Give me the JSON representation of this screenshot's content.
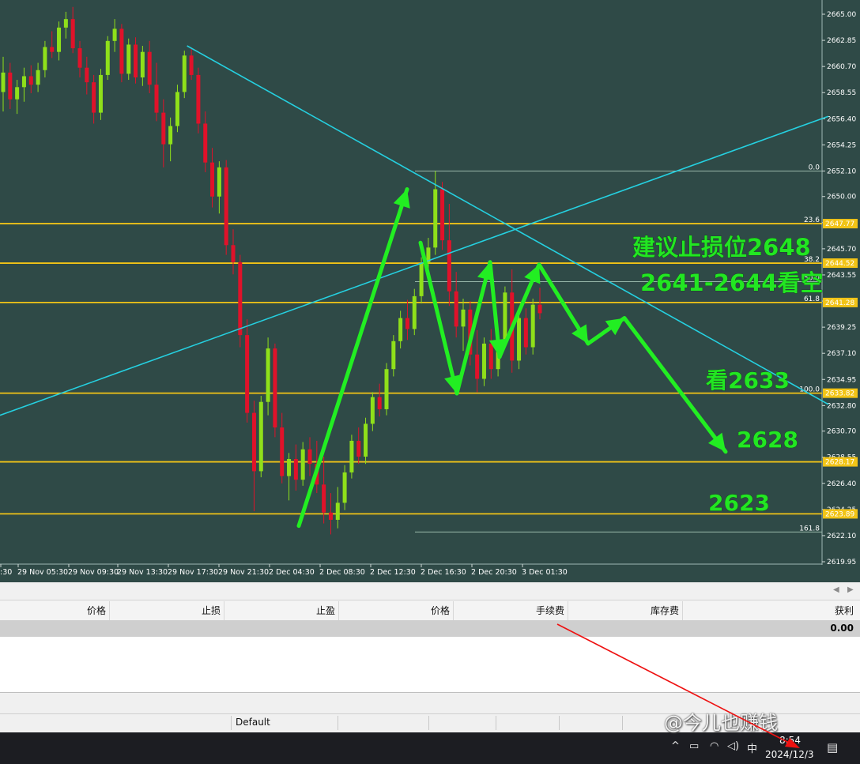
{
  "chart_data": {
    "type": "candlestick",
    "symbol_note": "",
    "ylim": [
      2619.95,
      2666.5
    ],
    "y_ticks": [
      "2665.00",
      "2662.85",
      "2660.70",
      "2658.55",
      "2656.40",
      "2654.25",
      "2652.10",
      "2650.00",
      "2647.85",
      "2645.70",
      "2643.55",
      "2641.40",
      "2639.25",
      "2637.10",
      "2634.95",
      "2632.80",
      "2630.70",
      "2628.55",
      "2626.40",
      "2624.25",
      "2622.10",
      "2619.95"
    ],
    "x_labels": [
      "29 Nov 01:30",
      "29 Nov 05:30",
      "29 Nov 09:30",
      "29 Nov 13:30",
      "29 Nov 17:30",
      "29 Nov 21:30",
      "2 Dec 04:30",
      "2 Dec 08:30",
      "2 Dec 12:30",
      "2 Dec 16:30",
      "2 Dec 20:30",
      "3 Dec 01:30"
    ],
    "x_label_display": [
      ":30",
      "29 Nov 05:30",
      "29 Nov 09:30",
      "29 Nov 13:30",
      "29 Nov 17:30",
      "29 Nov 21:30",
      "2 Dec 04:30",
      "2 Dec 08:30",
      "2 Dec 12:30",
      "2 Dec 16:30",
      "2 Dec 20:30",
      "3 Dec 01:30"
    ],
    "horizontal_levels": [
      {
        "price": 2647.77,
        "label": "2647.77"
      },
      {
        "price": 2644.52,
        "label": "2644.52"
      },
      {
        "price": 2641.28,
        "label": "2641.28"
      },
      {
        "price": 2633.82,
        "label": "2633.82"
      },
      {
        "price": 2628.17,
        "label": "2628.17"
      },
      {
        "price": 2623.89,
        "label": "2623.89"
      }
    ],
    "fibonacci": [
      {
        "ratio": "0.0",
        "price": 2652.1
      },
      {
        "ratio": "23.6",
        "price": 2647.77
      },
      {
        "ratio": "38.2",
        "price": 2644.52
      },
      {
        "ratio": "50.0",
        "price": 2643.0
      },
      {
        "ratio": "61.8",
        "price": 2641.28
      },
      {
        "ratio": "100.0",
        "price": 2633.82
      },
      {
        "ratio": "161.8",
        "price": 2622.4
      }
    ],
    "fib_visible_labels": [
      "0.0",
      "23.6",
      "38.2",
      "50.0",
      "61.8",
      "100.0",
      "161.8"
    ],
    "candles": [
      {
        "o": 2658.6,
        "h": 2661.5,
        "l": 2657.0,
        "c": 2660.2
      },
      {
        "o": 2660.2,
        "h": 2661.0,
        "l": 2657.2,
        "c": 2658.0
      },
      {
        "o": 2658.0,
        "h": 2659.6,
        "l": 2656.8,
        "c": 2659.0
      },
      {
        "o": 2659.0,
        "h": 2660.6,
        "l": 2657.8,
        "c": 2659.9
      },
      {
        "o": 2659.9,
        "h": 2660.8,
        "l": 2658.5,
        "c": 2659.2
      },
      {
        "o": 2659.2,
        "h": 2661.0,
        "l": 2658.6,
        "c": 2660.4
      },
      {
        "o": 2660.4,
        "h": 2662.8,
        "l": 2659.8,
        "c": 2662.3
      },
      {
        "o": 2662.3,
        "h": 2663.6,
        "l": 2661.4,
        "c": 2661.9
      },
      {
        "o": 2661.9,
        "h": 2664.4,
        "l": 2661.2,
        "c": 2663.9
      },
      {
        "o": 2663.9,
        "h": 2665.2,
        "l": 2663.0,
        "c": 2664.6
      },
      {
        "o": 2664.6,
        "h": 2665.6,
        "l": 2661.8,
        "c": 2662.2
      },
      {
        "o": 2662.2,
        "h": 2662.8,
        "l": 2659.8,
        "c": 2660.6
      },
      {
        "o": 2660.6,
        "h": 2661.5,
        "l": 2658.4,
        "c": 2659.4
      },
      {
        "o": 2659.4,
        "h": 2660.0,
        "l": 2656.0,
        "c": 2656.9
      },
      {
        "o": 2656.9,
        "h": 2660.5,
        "l": 2656.3,
        "c": 2660.0
      },
      {
        "o": 2660.0,
        "h": 2663.2,
        "l": 2659.6,
        "c": 2662.8
      },
      {
        "o": 2662.8,
        "h": 2664.6,
        "l": 2661.9,
        "c": 2663.8
      },
      {
        "o": 2663.8,
        "h": 2664.2,
        "l": 2659.4,
        "c": 2660.1
      },
      {
        "o": 2660.1,
        "h": 2663.0,
        "l": 2659.6,
        "c": 2662.5
      },
      {
        "o": 2662.5,
        "h": 2663.1,
        "l": 2659.3,
        "c": 2659.8
      },
      {
        "o": 2659.8,
        "h": 2662.4,
        "l": 2659.1,
        "c": 2661.9
      },
      {
        "o": 2661.9,
        "h": 2662.8,
        "l": 2658.5,
        "c": 2659.2
      },
      {
        "o": 2659.2,
        "h": 2661.0,
        "l": 2656.2,
        "c": 2656.9
      },
      {
        "o": 2656.9,
        "h": 2658.0,
        "l": 2652.4,
        "c": 2654.3
      },
      {
        "o": 2654.3,
        "h": 2656.5,
        "l": 2652.9,
        "c": 2655.8
      },
      {
        "o": 2655.8,
        "h": 2659.2,
        "l": 2655.3,
        "c": 2658.6
      },
      {
        "o": 2658.6,
        "h": 2662.0,
        "l": 2658.1,
        "c": 2661.6
      },
      {
        "o": 2661.6,
        "h": 2662.2,
        "l": 2659.6,
        "c": 2660.0
      },
      {
        "o": 2660.0,
        "h": 2660.6,
        "l": 2655.2,
        "c": 2656.0
      },
      {
        "o": 2656.0,
        "h": 2657.0,
        "l": 2652.0,
        "c": 2652.8
      },
      {
        "o": 2652.8,
        "h": 2654.0,
        "l": 2649.1,
        "c": 2650.0
      },
      {
        "o": 2650.0,
        "h": 2652.9,
        "l": 2648.6,
        "c": 2652.4
      },
      {
        "o": 2652.4,
        "h": 2653.0,
        "l": 2645.2,
        "c": 2646.0
      },
      {
        "o": 2646.0,
        "h": 2647.3,
        "l": 2643.6,
        "c": 2644.6
      },
      {
        "o": 2644.6,
        "h": 2645.2,
        "l": 2637.6,
        "c": 2638.6
      },
      {
        "o": 2638.6,
        "h": 2639.9,
        "l": 2631.4,
        "c": 2632.2
      },
      {
        "o": 2632.2,
        "h": 2633.2,
        "l": 2624.1,
        "c": 2627.4
      },
      {
        "o": 2627.4,
        "h": 2633.6,
        "l": 2626.9,
        "c": 2633.1
      },
      {
        "o": 2633.1,
        "h": 2638.4,
        "l": 2632.0,
        "c": 2637.5
      },
      {
        "o": 2637.5,
        "h": 2637.9,
        "l": 2630.2,
        "c": 2631.0
      },
      {
        "o": 2631.0,
        "h": 2632.2,
        "l": 2626.4,
        "c": 2627.0
      },
      {
        "o": 2627.0,
        "h": 2628.9,
        "l": 2625.0,
        "c": 2628.4
      },
      {
        "o": 2628.4,
        "h": 2629.6,
        "l": 2625.8,
        "c": 2626.7
      },
      {
        "o": 2626.7,
        "h": 2629.8,
        "l": 2626.2,
        "c": 2629.2
      },
      {
        "o": 2629.2,
        "h": 2630.2,
        "l": 2627.0,
        "c": 2628.0
      },
      {
        "o": 2628.0,
        "h": 2629.9,
        "l": 2625.6,
        "c": 2626.3
      },
      {
        "o": 2626.3,
        "h": 2628.6,
        "l": 2623.1,
        "c": 2624.0
      },
      {
        "o": 2624.0,
        "h": 2625.6,
        "l": 2622.2,
        "c": 2623.4
      },
      {
        "o": 2623.4,
        "h": 2626.1,
        "l": 2622.7,
        "c": 2624.8
      },
      {
        "o": 2624.8,
        "h": 2627.9,
        "l": 2624.2,
        "c": 2627.3
      },
      {
        "o": 2627.3,
        "h": 2630.4,
        "l": 2626.8,
        "c": 2629.9
      },
      {
        "o": 2629.9,
        "h": 2631.0,
        "l": 2628.0,
        "c": 2628.6
      },
      {
        "o": 2628.6,
        "h": 2631.8,
        "l": 2628.0,
        "c": 2631.3
      },
      {
        "o": 2631.3,
        "h": 2633.9,
        "l": 2630.7,
        "c": 2633.5
      },
      {
        "o": 2633.5,
        "h": 2634.6,
        "l": 2631.9,
        "c": 2632.5
      },
      {
        "o": 2632.5,
        "h": 2636.3,
        "l": 2632.0,
        "c": 2635.8
      },
      {
        "o": 2635.8,
        "h": 2638.6,
        "l": 2635.2,
        "c": 2638.1
      },
      {
        "o": 2638.1,
        "h": 2640.6,
        "l": 2637.5,
        "c": 2640.0
      },
      {
        "o": 2640.0,
        "h": 2641.5,
        "l": 2638.2,
        "c": 2639.1
      },
      {
        "o": 2639.1,
        "h": 2642.4,
        "l": 2638.6,
        "c": 2641.8
      },
      {
        "o": 2641.8,
        "h": 2645.0,
        "l": 2641.2,
        "c": 2644.5
      },
      {
        "o": 2644.5,
        "h": 2646.6,
        "l": 2643.6,
        "c": 2645.8
      },
      {
        "o": 2645.8,
        "h": 2652.1,
        "l": 2645.2,
        "c": 2650.6
      },
      {
        "o": 2650.6,
        "h": 2651.2,
        "l": 2645.6,
        "c": 2646.4
      },
      {
        "o": 2646.4,
        "h": 2649.4,
        "l": 2641.0,
        "c": 2642.2
      },
      {
        "o": 2642.2,
        "h": 2643.8,
        "l": 2638.4,
        "c": 2639.3
      },
      {
        "o": 2639.3,
        "h": 2641.6,
        "l": 2637.3,
        "c": 2640.7
      },
      {
        "o": 2640.7,
        "h": 2641.4,
        "l": 2636.1,
        "c": 2637.0
      },
      {
        "o": 2637.0,
        "h": 2639.0,
        "l": 2633.9,
        "c": 2635.0
      },
      {
        "o": 2635.0,
        "h": 2638.4,
        "l": 2634.4,
        "c": 2637.9
      },
      {
        "o": 2637.9,
        "h": 2639.1,
        "l": 2635.0,
        "c": 2635.8
      },
      {
        "o": 2635.8,
        "h": 2638.6,
        "l": 2635.2,
        "c": 2638.0
      },
      {
        "o": 2638.0,
        "h": 2642.6,
        "l": 2637.6,
        "c": 2642.1
      },
      {
        "o": 2642.1,
        "h": 2644.0,
        "l": 2635.5,
        "c": 2636.5
      },
      {
        "o": 2636.5,
        "h": 2640.5,
        "l": 2635.8,
        "c": 2640.0
      },
      {
        "o": 2640.0,
        "h": 2640.8,
        "l": 2637.0,
        "c": 2637.6
      },
      {
        "o": 2637.6,
        "h": 2641.6,
        "l": 2637.0,
        "c": 2641.1
      },
      {
        "o": 2641.1,
        "h": 2642.5,
        "l": 2639.9,
        "c": 2640.4
      }
    ],
    "trendlines": [
      {
        "name": "descending",
        "from": [
          2662.4,
          0.2175
        ],
        "to": [
          2632.9,
          0.9632
        ],
        "color": "#25d0e0"
      },
      {
        "name": "ascending",
        "from": [
          2632.0,
          0.0
        ],
        "to": [
          2656.6,
          0.9632
        ],
        "color": "#25d0e0"
      }
    ],
    "annotations": [
      {
        "text": "建议止损位2648"
      },
      {
        "text": "2641-2644看空"
      },
      {
        "text": "看2633"
      },
      {
        "text": "2628"
      },
      {
        "text": "2623"
      }
    ]
  },
  "terminal": {
    "columns": [
      "价格",
      "止损",
      "止盈",
      "价格",
      "手续费",
      "库存费",
      "获利"
    ],
    "balance_profit": "0.00",
    "profile": "Default"
  },
  "taskbar": {
    "ime": "中",
    "time": "8:54",
    "date": "2024/12/3"
  },
  "watermark": "@今儿也赚钱",
  "colors": {
    "background": "#2f4a47",
    "bull": "#8fe01a",
    "bear": "#e0122a",
    "levels": "#f2c417",
    "trend": "#25d0e0",
    "arrows": "#22ee22"
  }
}
